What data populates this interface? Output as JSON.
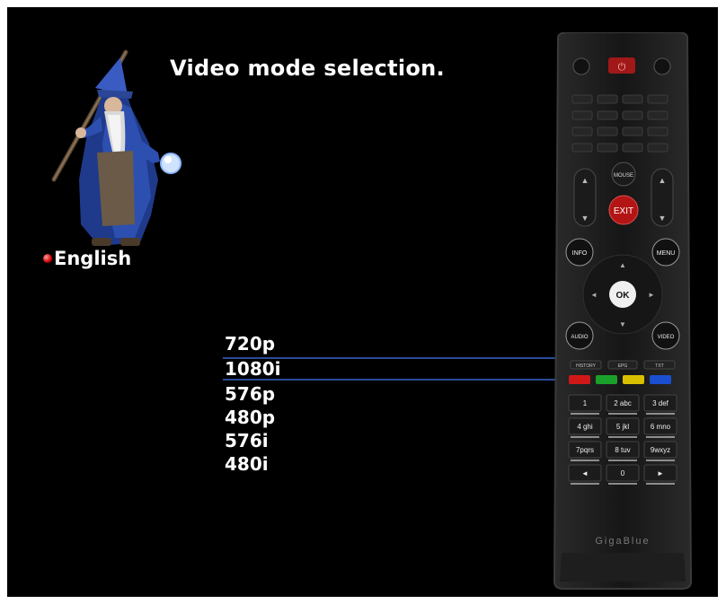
{
  "title": "Video mode selection.",
  "language": {
    "label": "English"
  },
  "menu": {
    "selected_index": 1,
    "options": [
      "720p",
      "1080i",
      "576p",
      "480p",
      "576i",
      "480i"
    ]
  },
  "remote": {
    "brand": "GigaBlue",
    "buttons": {
      "mouse": "MOUSE",
      "exit": "EXIT",
      "info": "INFO",
      "menu": "MENU",
      "ok": "OK",
      "audio": "AUDIO",
      "video": "VIDEO",
      "history": "HISTORY",
      "epg": "EPG",
      "txt": "TXT",
      "k1": "1",
      "k2": "2 abc",
      "k3": "3 def",
      "k4": "4 ghi",
      "k5": "5 jkl",
      "k6": "6 mno",
      "k7": "7pqrs",
      "k8": "8 tuv",
      "k9": "9wxyz",
      "k0": "0",
      "left": "◄",
      "right": "►"
    },
    "color_keys": [
      "#d01818",
      "#1aa02a",
      "#d8c000",
      "#1a4fd0"
    ]
  },
  "colors": {
    "background": "#000000",
    "selection_line": "#2a4b9a",
    "text": "#ffffff"
  }
}
